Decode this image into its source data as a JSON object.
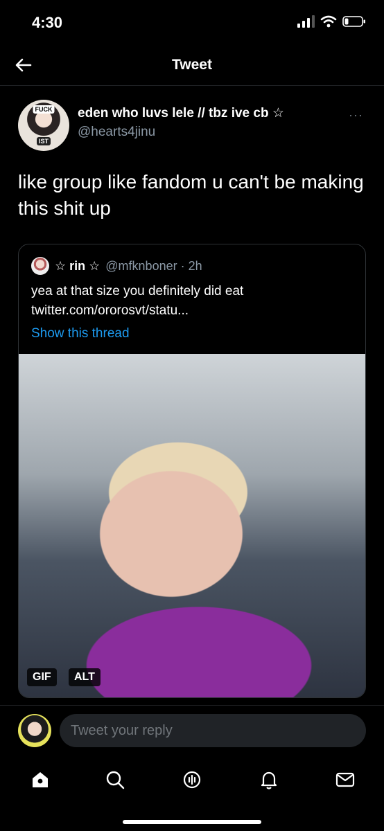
{
  "status_bar": {
    "time": "4:30"
  },
  "header": {
    "title": "Tweet"
  },
  "tweet": {
    "author_name": "eden who luvs lele // tbz ive cb ☆",
    "author_handle": "@hearts4jinu",
    "avatar_tag_top": "FUCK",
    "avatar_tag_bottom": "IST",
    "more": "···",
    "text": "like group like fandom u can't be making this shit up"
  },
  "quote": {
    "name": "☆ rin ☆",
    "handle_time": "@mfknboner · 2h",
    "text": "yea at that size you definitely did eat twitter.com/ororosvt/statu...",
    "show_thread": "Show this thread",
    "badges": {
      "gif": "GIF",
      "alt": "ALT"
    }
  },
  "reply": {
    "placeholder": "Tweet your reply"
  },
  "tabs": [
    {
      "icon": "home-icon"
    },
    {
      "icon": "search-icon"
    },
    {
      "icon": "spaces-icon"
    },
    {
      "icon": "notifications-icon"
    },
    {
      "icon": "messages-icon"
    }
  ],
  "colors": {
    "background": "#000000",
    "link": "#1d9bf0",
    "muted": "#8b98a5"
  }
}
